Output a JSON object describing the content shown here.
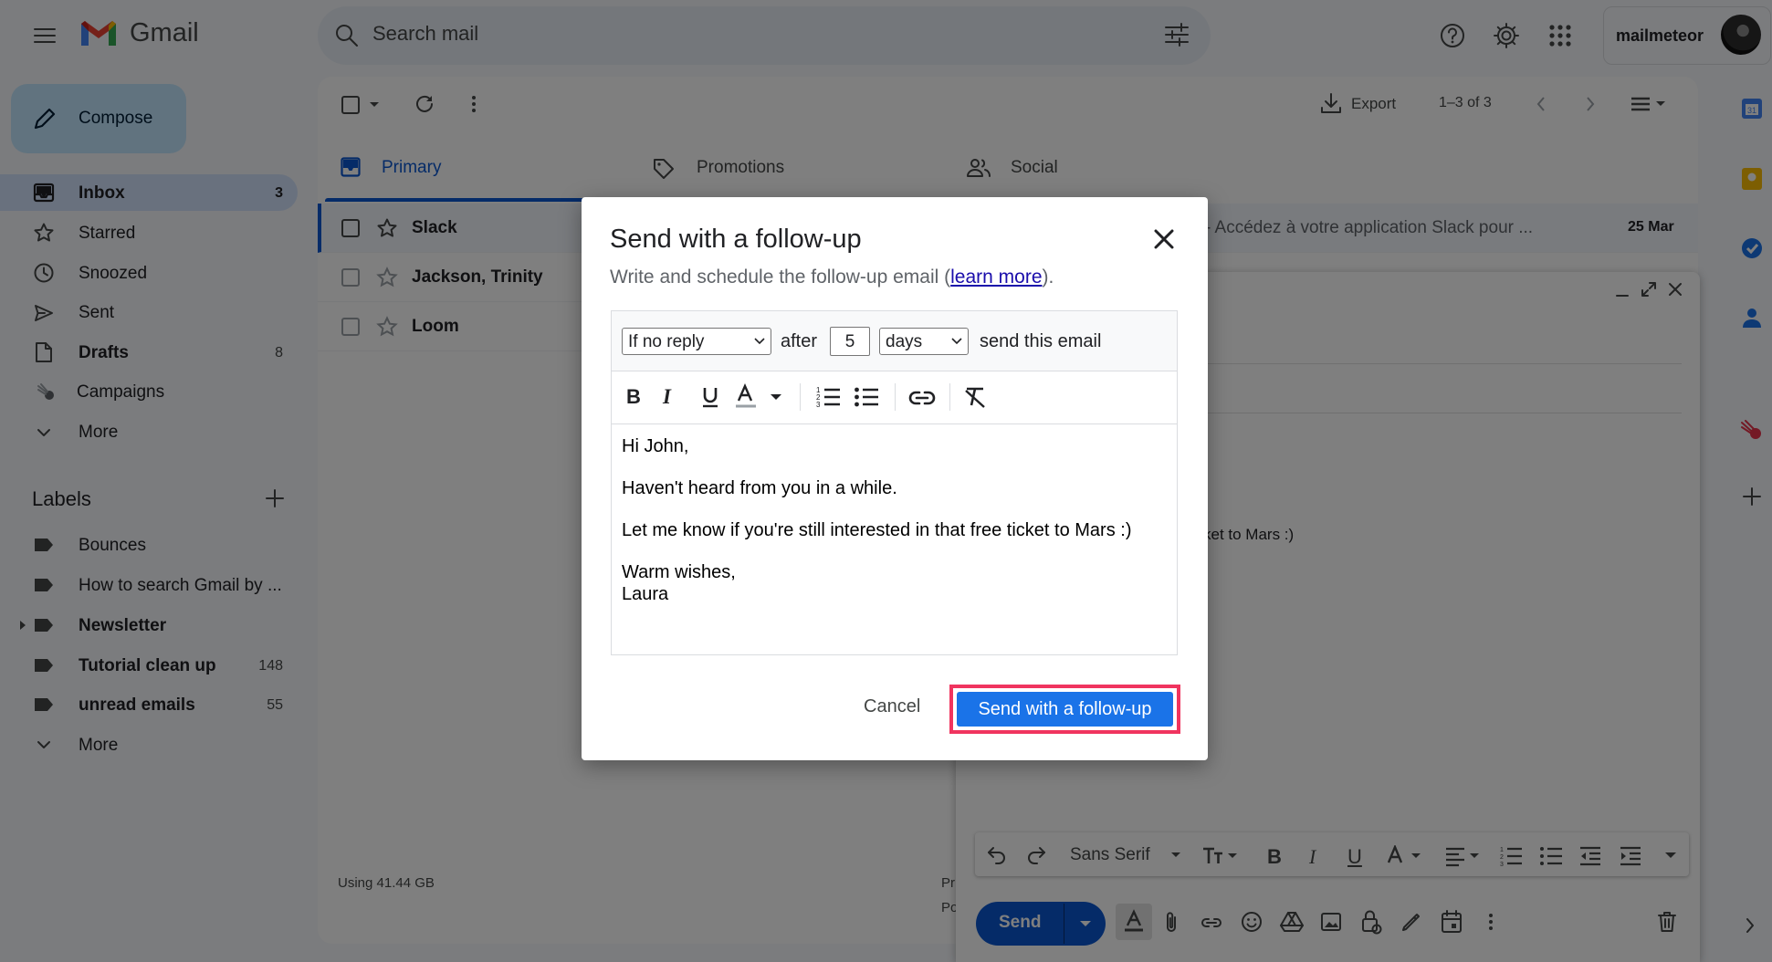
{
  "app": {
    "logo_text": "Gmail",
    "search_placeholder": "Search mail",
    "account_name": "mailmeteor"
  },
  "sidebar": {
    "compose_label": "Compose",
    "items": [
      {
        "label": "Inbox",
        "count": "3",
        "icon": "inbox-icon"
      },
      {
        "label": "Starred",
        "count": "",
        "icon": "star-icon"
      },
      {
        "label": "Snoozed",
        "count": "",
        "icon": "clock-icon"
      },
      {
        "label": "Sent",
        "count": "",
        "icon": "send-icon"
      },
      {
        "label": "Drafts",
        "count": "8",
        "icon": "file-icon"
      },
      {
        "label": "Campaigns",
        "count": "",
        "icon": "meteor-icon"
      },
      {
        "label": "More",
        "count": "",
        "icon": "chevron-down-icon"
      }
    ],
    "labels_title": "Labels",
    "labels": [
      {
        "label": "Bounces",
        "count": ""
      },
      {
        "label": "How to search Gmail by ...",
        "count": ""
      },
      {
        "label": "Newsletter",
        "count": ""
      },
      {
        "label": "Tutorial clean up",
        "count": "148"
      },
      {
        "label": "unread emails",
        "count": "55"
      }
    ],
    "labels_more": "More",
    "storage": "Using 41.44 GB"
  },
  "toolbar": {
    "export_label": "Export",
    "range_label": "1–3 of 3"
  },
  "tabs": [
    {
      "label": "Primary",
      "icon": "inbox-icon"
    },
    {
      "label": "Promotions",
      "icon": "tag-icon"
    },
    {
      "label": "Social",
      "icon": "people-icon"
    }
  ],
  "emails": [
    {
      "sender": "Slack",
      "snippet": "- Accédez à votre application Slack pour ...",
      "date": "25 Mar"
    },
    {
      "sender": "Jackson, Trinity",
      "snippet": "",
      "date": ""
    },
    {
      "sender": "Loom",
      "snippet": "",
      "date": ""
    }
  ],
  "compose_window": {
    "body_fragment": "ket to Mars :)",
    "font_label": "Sans Serif",
    "send_label": "Send",
    "frag_1": "Pr",
    "frag_2": "Po"
  },
  "modal": {
    "title": "Send with a follow-up",
    "subtitle_prefix": "Write and schedule the follow-up email (",
    "subtitle_link": "learn more",
    "subtitle_suffix": ").",
    "condition_value": "If no reply",
    "after_label": "after",
    "delay_value": "5",
    "unit_value": "days",
    "send_this_label": "send this email",
    "body": {
      "line1": "Hi John,",
      "line2": "Haven't heard from you in a while.",
      "line3": "Let me know if you're still interested in that free ticket to Mars :)",
      "line4": "Warm wishes,",
      "line5": "Laura"
    },
    "cancel_label": "Cancel",
    "confirm_label": "Send with a follow-up"
  },
  "colors": {
    "primary_button": "#1a73e8",
    "highlight_border": "#f0345f",
    "gmail_accent": "#0b57d0"
  }
}
